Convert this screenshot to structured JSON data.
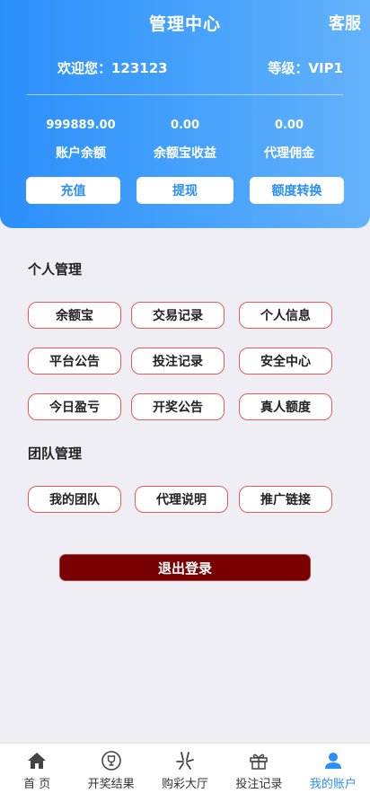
{
  "header": {
    "title": "管理中心",
    "service_label": "客服",
    "welcome": "欢迎您：123123",
    "level": "等级：VIP1"
  },
  "stats": [
    {
      "value": "999889.00",
      "label": "账户余额"
    },
    {
      "value": "0.00",
      "label": "余额宝收益"
    },
    {
      "value": "0.00",
      "label": "代理佣金"
    }
  ],
  "actions": {
    "recharge": "充值",
    "withdraw": "提现",
    "transfer": "额度转换"
  },
  "personal": {
    "title": "个人管理",
    "items": [
      "余额宝",
      "交易记录",
      "个人信息",
      "平台公告",
      "投注记录",
      "安全中心",
      "今日盈亏",
      "开奖公告",
      "真人额度"
    ]
  },
  "team": {
    "title": "团队管理",
    "items": [
      "我的团队",
      "代理说明",
      "推广链接"
    ]
  },
  "logout_label": "退出登录",
  "tabbar": {
    "active_color": "#2b8ffb",
    "items": [
      {
        "label": "首 页",
        "icon": "home-icon"
      },
      {
        "label": "开奖结果",
        "icon": "trophy-icon"
      },
      {
        "label": "购彩大厅",
        "icon": "lottery-icon"
      },
      {
        "label": "投注记录",
        "icon": "gift-icon"
      },
      {
        "label": "我的账户",
        "icon": "user-icon",
        "active": true
      }
    ]
  }
}
